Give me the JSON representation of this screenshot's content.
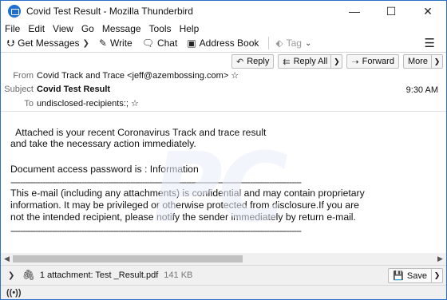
{
  "window": {
    "title": "Covid Test Result - Mozilla Thunderbird",
    "minimize_glyph": "—",
    "maximize_glyph": "☐",
    "close_glyph": "✕"
  },
  "menu": [
    "File",
    "Edit",
    "View",
    "Go",
    "Message",
    "Tools",
    "Help"
  ],
  "toolbar": {
    "get_messages": "Get Messages",
    "write": "Write",
    "chat": "Chat",
    "address_book": "Address Book",
    "tag": "Tag",
    "menu_icon": "hamburger-icon"
  },
  "header_buttons": {
    "reply": "Reply",
    "reply_all": "Reply All",
    "forward": "Forward",
    "more": "More"
  },
  "header": {
    "from_label": "From",
    "from_value": "Covid Track and Trace <jeff@azembossing.com>",
    "subject_label": "Subject",
    "subject_value": "Covid Test Result",
    "to_label": "To",
    "to_value": "undisclosed-recipients:;",
    "time": "9:30 AM"
  },
  "body": {
    "line1": "  Attached is your recent Coronavirus Track and trace result",
    "line2": "and take the necessary action immediately.",
    "line3": "Document access password is : Information",
    "disclaimer1": "This e-mail (including any attachments) is confidential and may contain proprietary",
    "disclaimer2": "information. It may be privileged or otherwise protected from disclosure.If you are",
    "disclaimer3": "not the intended recipient, please notify the sender immediately by return e-mail."
  },
  "attachment": {
    "label": "1 attachment: Test _Result.pdf",
    "size": "141 KB",
    "save": "Save"
  },
  "colors": {
    "accent": "#2b6fc9",
    "bar_bg": "#f0f0f0"
  }
}
